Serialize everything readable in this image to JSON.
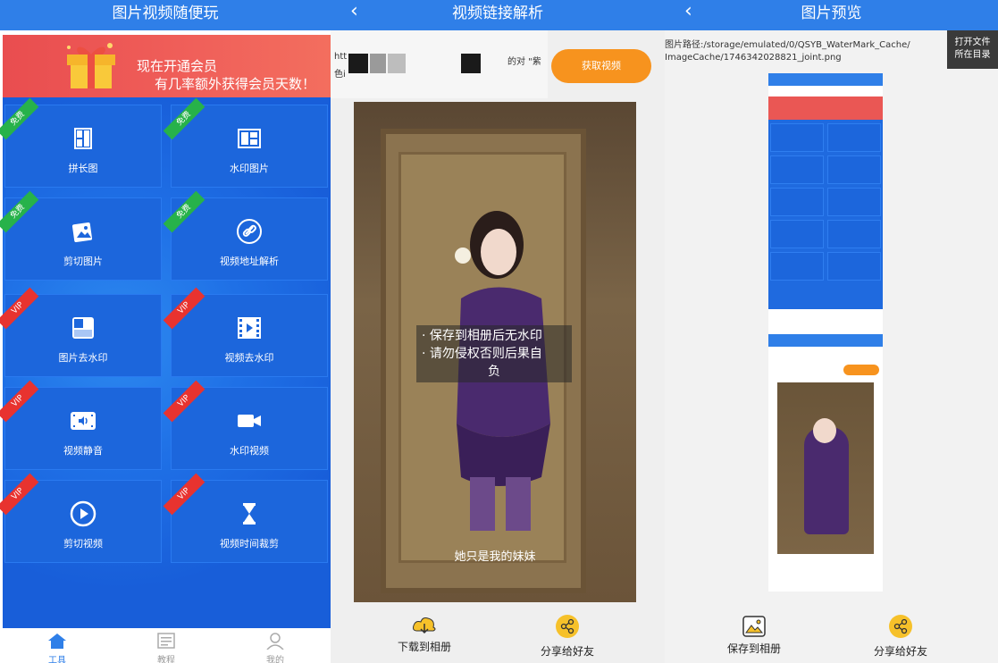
{
  "panel1": {
    "title": "图片视频随便玩",
    "banner": {
      "line1": "现在开通会员",
      "line2": "有几率额外获得会员天数！"
    },
    "tiles": [
      {
        "label": "拼长图",
        "badge": "免费"
      },
      {
        "label": "水印图片",
        "badge": "免费"
      },
      {
        "label": "剪切图片",
        "badge": "免费"
      },
      {
        "label": "视频地址解析",
        "badge": "免费"
      },
      {
        "label": "图片去水印",
        "badge": "VIP"
      },
      {
        "label": "视频去水印",
        "badge": "VIP"
      },
      {
        "label": "视频静音",
        "badge": "VIP"
      },
      {
        "label": "水印视频",
        "badge": "VIP"
      },
      {
        "label": "剪切视频",
        "badge": "VIP"
      },
      {
        "label": "视频时间裁剪",
        "badge": "VIP"
      }
    ],
    "nav": [
      "工具",
      "教程",
      "我的"
    ]
  },
  "panel2": {
    "title": "视频链接解析",
    "url_text1": "htt",
    "url_text2": "色i",
    "url_text3": "的对 \"紫",
    "fetch_button": "获取视频",
    "notice_line1": "· 保存到相册后无水印",
    "notice_line2": "· 请勿侵权否则后果自",
    "notice_line3": "负",
    "subtitle": "她只是我的妹妹",
    "actions": [
      "下载到相册",
      "分享给好友"
    ]
  },
  "panel3": {
    "title": "图片预览",
    "path_line1": "图片路径:/storage/emulated/0/QSYB_WaterMark_Cache/",
    "path_line2": "ImageCache/1746342028821_joint.png",
    "open_button_line1": "打开文件",
    "open_button_line2": "所在目录",
    "actions": [
      "保存到相册",
      "分享给好友"
    ]
  },
  "colors": {
    "header_blue": "#2f7fe8",
    "tile_blue": "#1c66dc",
    "accent_orange": "#f7931e",
    "free_green": "#27b24a",
    "vip_red": "#e8332f"
  }
}
